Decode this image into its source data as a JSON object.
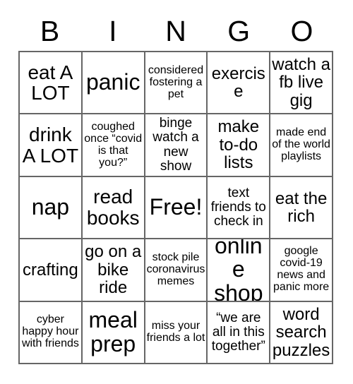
{
  "header": {
    "letters": [
      "B",
      "I",
      "N",
      "G",
      "O"
    ]
  },
  "grid": {
    "columns": 5,
    "rows": 5,
    "border_color": "#666666",
    "background_color": "#ffffff",
    "text_color": "#000000",
    "cells": [
      {
        "text": "eat A LOT",
        "size": "s-lg",
        "free": false
      },
      {
        "text": "panic",
        "size": "s-xl",
        "free": false
      },
      {
        "text": "considered fostering a pet",
        "size": "s-xs",
        "free": false
      },
      {
        "text": "exercise",
        "size": "s-md",
        "free": false
      },
      {
        "text": "watch a fb live gig",
        "size": "s-md",
        "free": false
      },
      {
        "text": "drink A LOT",
        "size": "s-lg",
        "free": false
      },
      {
        "text": "coughed once “covid is that you?”",
        "size": "s-xs",
        "free": false
      },
      {
        "text": "binge watch a new show",
        "size": "s-sm",
        "free": false
      },
      {
        "text": "make to-do lists",
        "size": "s-md",
        "free": false
      },
      {
        "text": "made end of the world playlists",
        "size": "s-xs",
        "free": false
      },
      {
        "text": "nap",
        "size": "s-xl",
        "free": false
      },
      {
        "text": "read books",
        "size": "s-lg",
        "free": false
      },
      {
        "text": "Free!",
        "size": "s-xl",
        "free": true
      },
      {
        "text": "text friends to check in",
        "size": "s-sm",
        "free": false
      },
      {
        "text": "eat the rich",
        "size": "s-md",
        "free": false
      },
      {
        "text": "crafting",
        "size": "s-md",
        "free": false
      },
      {
        "text": "go on a bike ride",
        "size": "s-md",
        "free": false
      },
      {
        "text": "stock pile coronavirus memes",
        "size": "s-xs",
        "free": false
      },
      {
        "text": "online shop",
        "size": "s-xl",
        "free": false
      },
      {
        "text": "google covid-19 news and panic more",
        "size": "s-xs",
        "free": false
      },
      {
        "text": "cyber happy hour with friends",
        "size": "s-xs",
        "free": false
      },
      {
        "text": "meal prep",
        "size": "s-xl",
        "free": false
      },
      {
        "text": "miss your friends a lot",
        "size": "s-xs",
        "free": false
      },
      {
        "text": "“we are all in this together”",
        "size": "s-sm",
        "free": false
      },
      {
        "text": "word search puzzles",
        "size": "s-md",
        "free": false
      }
    ]
  }
}
